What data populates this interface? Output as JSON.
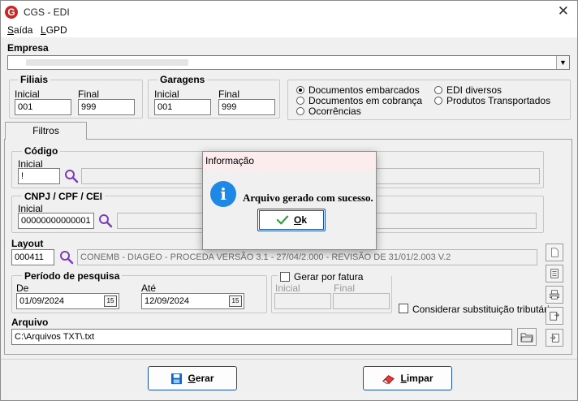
{
  "window": {
    "title": "CGS - EDI",
    "close_glyph": "✕",
    "logo_letter": "G"
  },
  "menu": {
    "items": [
      {
        "label": "Saída",
        "accel": "S",
        "rest": "aída"
      },
      {
        "label": "LGPD",
        "accel": "L",
        "rest": "GPD"
      }
    ]
  },
  "empresa": {
    "label": "Empresa",
    "value": ""
  },
  "filiais": {
    "title": "Filiais",
    "inicial_label": "Inicial",
    "final_label": "Final",
    "inicial_value": "001",
    "final_value": "999"
  },
  "garagens": {
    "title": "Garagens",
    "inicial_label": "Inicial",
    "final_label": "Final",
    "inicial_value": "001",
    "final_value": "999"
  },
  "doc_types": {
    "options": [
      {
        "label": "Documentos embarcados",
        "selected": true
      },
      {
        "label": "Documentos em cobrança",
        "selected": false
      },
      {
        "label": "Ocorrências",
        "selected": false
      },
      {
        "label": "EDI diversos",
        "selected": false
      },
      {
        "label": "Produtos Transportados",
        "selected": false
      }
    ]
  },
  "tabs": [
    {
      "label": "Filtros",
      "active": true
    }
  ],
  "codigo": {
    "title": "Código",
    "inicial_label": "Inicial",
    "inicial_value": "!",
    "description": ""
  },
  "cnpj": {
    "title": "CNPJ / CPF / CEI",
    "inicial_label": "Inicial",
    "inicial_value": "00000000000001",
    "description": ""
  },
  "layout": {
    "title": "Layout",
    "code": "000411",
    "description": "CONEMB - DIAGEO  - PROCEDA VERSÃO 3.1 - 27/04/2.000 - REVISÃO DE 31/01/2.003 V.2"
  },
  "periodo": {
    "title": "Período de pesquisa",
    "de_label": "De",
    "ate_label": "Até",
    "de_value": "01/09/2024",
    "ate_value": "12/09/2024",
    "calendar_glyph": "15"
  },
  "gerar_fatura": {
    "label": "Gerar por fatura",
    "checked": false,
    "inicial_label": "Inicial",
    "final_label": "Final"
  },
  "substituicao": {
    "label": "Considerar substituição tributária",
    "checked": false
  },
  "arquivo": {
    "title": "Arquivo",
    "value": "C:\\Arquivos TXT\\.txt"
  },
  "actions": {
    "gerar": {
      "accel": "G",
      "rest": "erar"
    },
    "limpar": {
      "accel": "L",
      "rest": "impar"
    }
  },
  "dialog": {
    "title": "Informação",
    "message": "Arquivo gerado com sucesso.",
    "ok_accel": "O",
    "ok_rest": "k",
    "icon_letter": "i"
  },
  "colors": {
    "accent": "#1f4e9a",
    "info_blue": "#1e88e5",
    "search_purple": "#7b3fb5",
    "dialog_title_bg": "#fcecee"
  }
}
